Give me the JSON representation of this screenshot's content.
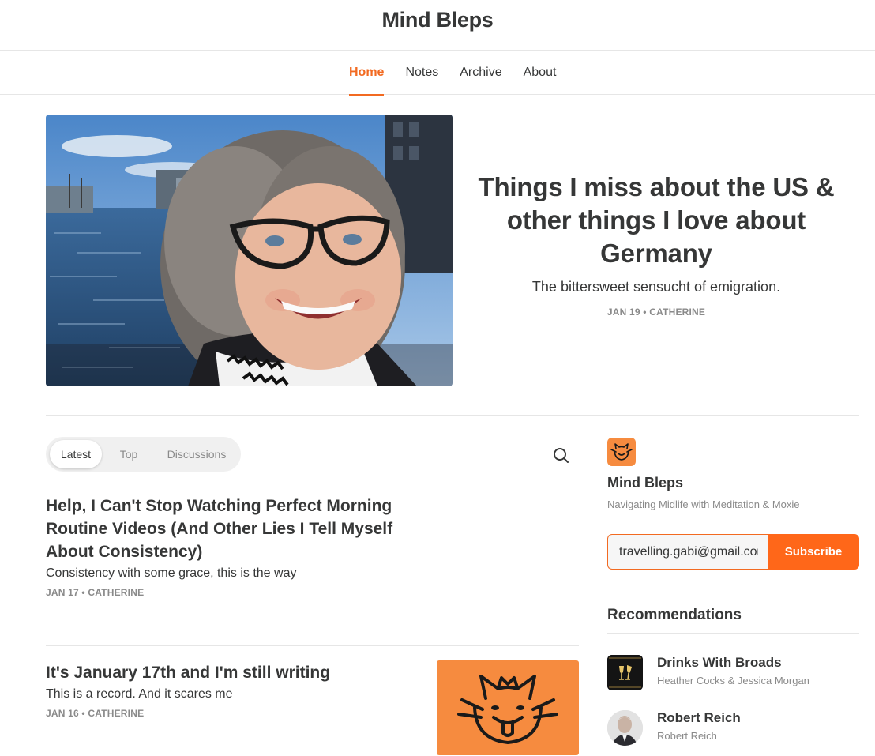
{
  "site": {
    "title": "Mind Bleps"
  },
  "nav": {
    "items": [
      {
        "label": "Home",
        "active": true
      },
      {
        "label": "Notes",
        "active": false
      },
      {
        "label": "Archive",
        "active": false
      },
      {
        "label": "About",
        "active": false
      }
    ]
  },
  "hero": {
    "title": "Things I miss about the US & other things I love about Germany",
    "subtitle": "The bittersweet sensucht of emigration.",
    "meta": "JAN 19 • CATHERINE"
  },
  "tabs": [
    {
      "label": "Latest",
      "active": true
    },
    {
      "label": "Top",
      "active": false
    },
    {
      "label": "Discussions",
      "active": false
    }
  ],
  "posts": [
    {
      "title": "Help, I Can't Stop Watching Perfect Morning Routine Videos (And Other Lies I Tell Myself About Consistency)",
      "subtitle": "Consistency with some grace, this is the way",
      "meta": "JAN 17 • CATHERINE"
    },
    {
      "title": "It's January 17th and I'm still writing",
      "subtitle": "This is a record. And it scares me",
      "meta": "JAN 16 • CATHERINE"
    }
  ],
  "sidebar": {
    "pub_name": "Mind Bleps",
    "pub_description": "Navigating Midlife with Meditation & Moxie",
    "email_value": "travelling.gabi@gmail.com",
    "subscribe_label": "Subscribe",
    "recommendations_heading": "Recommendations",
    "recommendations": [
      {
        "name": "Drinks With Broads",
        "authors": "Heather Cocks & Jessica Morgan",
        "icon": "champagne-glasses-icon"
      },
      {
        "name": "Robert Reich",
        "authors": "Robert Reich",
        "icon": "avatar-photo"
      }
    ]
  },
  "colors": {
    "accent": "#ff6719",
    "brand_orange": "#f68b3f",
    "text": "#363737",
    "muted": "#8a8a8a"
  }
}
